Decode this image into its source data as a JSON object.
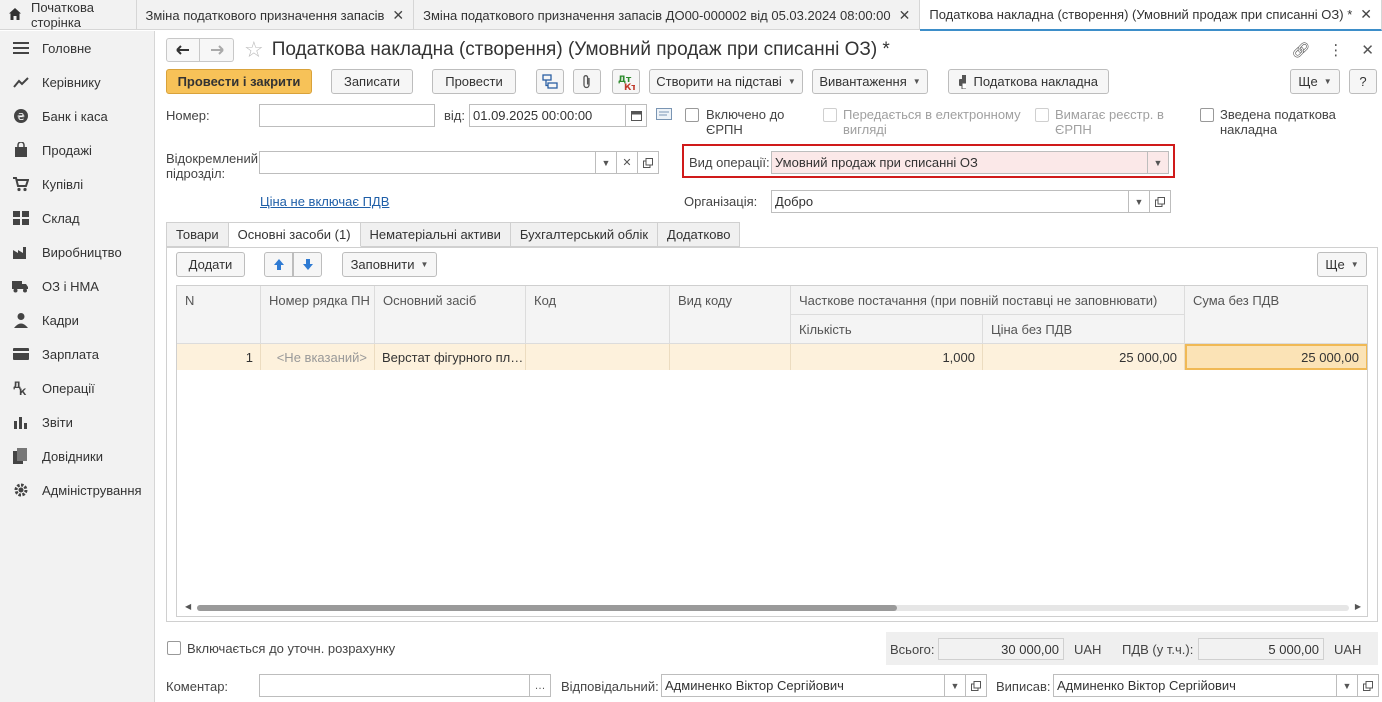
{
  "top_tabs": {
    "home": "Початкова сторінка",
    "tabs": [
      {
        "label": "Зміна податкового призначення запасів",
        "active": false
      },
      {
        "label": "Зміна податкового призначення запасів ДО00-000002 від 05.03.2024 08:00:00",
        "active": false
      },
      {
        "label": "Податкова накладна (створення) (Умовний продаж при списанні ОЗ) *",
        "active": true
      }
    ]
  },
  "sidebar": {
    "items": [
      {
        "label": "Головне",
        "icon": "menu-icon"
      },
      {
        "label": "Керівнику",
        "icon": "trend-icon"
      },
      {
        "label": "Банк і каса",
        "icon": "coin-icon"
      },
      {
        "label": "Продажі",
        "icon": "bag-icon"
      },
      {
        "label": "Купівлі",
        "icon": "cart-icon"
      },
      {
        "label": "Склад",
        "icon": "warehouse-icon"
      },
      {
        "label": "Виробництво",
        "icon": "factory-icon"
      },
      {
        "label": "ОЗ і НМА",
        "icon": "truck-icon"
      },
      {
        "label": "Кадри",
        "icon": "person-icon"
      },
      {
        "label": "Зарплата",
        "icon": "wallet-icon"
      },
      {
        "label": "Операції",
        "icon": "operations-icon"
      },
      {
        "label": "Звіти",
        "icon": "bar-chart-icon"
      },
      {
        "label": "Довідники",
        "icon": "books-icon"
      },
      {
        "label": "Адміністрування",
        "icon": "gear-icon"
      }
    ]
  },
  "form": {
    "title": "Податкова накладна (створення) (Умовний продаж при списанні ОЗ) *",
    "toolbar": {
      "post_close": "Провести і закрити",
      "save": "Записати",
      "post": "Провести",
      "create_based": "Створити на підставі",
      "export": "Вивантаження",
      "print": "Податкова накладна",
      "more": "Ще",
      "help": "?"
    },
    "number_label": "Номер:",
    "number_value": "",
    "date_label": "від:",
    "date_value": "01.09.2025 00:00:00",
    "checks": {
      "erpn": "Включено до ЄРПН",
      "electronic": "Передається в електронному вигляді",
      "requires_reg": "Вимагає реєстр. в ЄРПН",
      "consolidated": "Зведена податкова накладна"
    },
    "subdivision_label": "Відокремлений підрозділ:",
    "subdivision_value": "",
    "operation_label": "Вид операції:",
    "operation_value": "Умовний продаж при списанні ОЗ",
    "price_link": "Ціна не включає ПДВ",
    "org_label": "Організація:",
    "org_value": "Добро",
    "tabs": [
      "Товари",
      "Основні засоби (1)",
      "Нематеріальні активи",
      "Бухгалтерський облік",
      "Додатково"
    ],
    "active_tab": 1,
    "table_toolbar": {
      "add": "Додати",
      "fill": "Заповнити",
      "more": "Ще"
    },
    "table": {
      "headers": {
        "n": "N",
        "row_number": "Номер рядка ПН",
        "asset": "Основний засіб",
        "code": "Код",
        "code_type": "Вид коду",
        "partial": "Часткове постачання (при повній поставці не заповнювати)",
        "qty": "Кількість",
        "price": "Ціна без ПДВ",
        "sum": "Сума без ПДВ"
      },
      "rows": [
        {
          "n": "1",
          "row_number": "<Не вказаний>",
          "asset": "Верстат фігурного пл…",
          "code": "",
          "code_type": "",
          "qty": "1,000",
          "price": "25 000,00",
          "sum": "25 000,00"
        }
      ]
    },
    "refinement_check": "Включається до уточн. розрахунку",
    "total_label": "Всього:",
    "total_value": "30 000,00",
    "currency": "UAH",
    "vat_label": "ПДВ (у т.ч.):",
    "vat_value": "5 000,00",
    "comment_label": "Коментар:",
    "comment_value": "",
    "responsible_label": "Відповідальний:",
    "responsible_value": "Админенко Віктор Сергійович",
    "issued_label": "Виписав:",
    "issued_value": "Админенко Віктор Сергійович"
  }
}
